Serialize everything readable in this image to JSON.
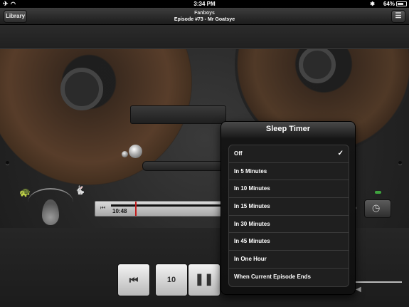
{
  "status_bar": {
    "time": "3:34 PM",
    "battery": "64%",
    "battery_level": 0.64,
    "airplane_icon": "airplane-icon",
    "wifi_icon": "wifi-icon",
    "bluetooth_icon": "bluetooth-icon"
  },
  "nav": {
    "library_label": "Library",
    "title": "Fanboys",
    "subtitle": "Episode #73 - Mr Goatsye",
    "list_icon": "list-icon"
  },
  "player": {
    "elapsed": "10:48",
    "progress": 0.2,
    "transport": {
      "previous_icon": "skip-back-icon",
      "rewind_icon": "rewind-10-icon",
      "rewind_text": "10",
      "pause_icon": "pause-icon"
    },
    "speed": {
      "slow_icon": "turtle-icon",
      "fast_icon": "rabbit-icon"
    }
  },
  "sleep_timer": {
    "title": "Sleep Timer",
    "selected": "Off",
    "options": [
      "Off",
      "In 5 Minutes",
      "In 10 Minutes",
      "In 15 Minutes",
      "In 30 Minutes",
      "In 45 Minutes",
      "In One Hour",
      "When Current Episode Ends"
    ]
  },
  "colors": {
    "playhead": "#c21d1d",
    "led": "#3fa33f"
  }
}
